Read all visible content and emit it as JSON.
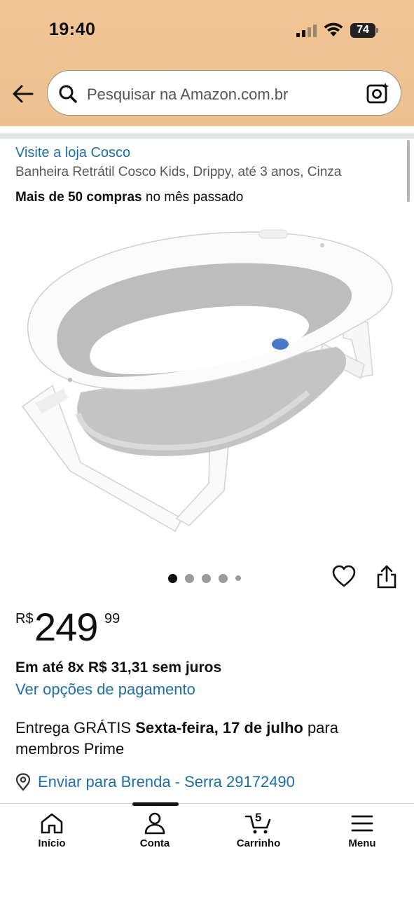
{
  "status_bar": {
    "time": "19:40",
    "battery": "74"
  },
  "header": {
    "search_placeholder": "Pesquisar na Amazon.com.br"
  },
  "product": {
    "store_link": "Visite a loja Cosco",
    "title": "Banheira Retrátil Cosco Kids, Drippy, até 3 anos, Cinza",
    "purchases_bold": "Mais de 50 compras",
    "purchases_rest": " no mês passado",
    "image_count": 5,
    "active_image": 1
  },
  "price": {
    "currency": "R$",
    "whole": "249",
    "fraction": "99"
  },
  "installments": "Em até 8x R$ 31,31 sem juros",
  "payment_link": "Ver opções de pagamento",
  "delivery": {
    "prefix": "Entrega GRÁTIS ",
    "date": "Sexta-feira, 17 de julho",
    "suffix": " para membros Prime"
  },
  "ship_to": "Enviar para Brenda - Serra 29172490",
  "bottom_nav": {
    "home": "Início",
    "account": "Conta",
    "cart": "Carrinho",
    "cart_count": "5",
    "menu": "Menu"
  },
  "colors": {
    "header": "#f0c494",
    "link": "#1f6fa5",
    "text": "#0f1111"
  }
}
